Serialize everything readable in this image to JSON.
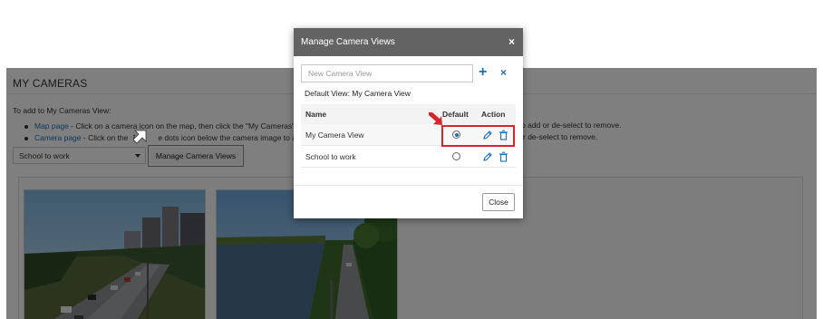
{
  "page": {
    "title": "MY CAMERAS",
    "intro": "To add to My Cameras View:",
    "bullet1_link": "Map page",
    "bullet1_text": " - Click on a camera icon on the map, then click the \"My Cameras\" bu",
    "bullet1_tail": "o add or de-select to remove.",
    "bullet2_link": "Camera page",
    "bullet2_text": " - Click on the  ",
    "bullet2_mid": "e dots icon below the camera image to acce",
    "bullet2_tail": "r de-select to remove.",
    "view_select_value": "School to work",
    "manage_button": "Manage Camera Views"
  },
  "modal": {
    "title": "Manage Camera Views",
    "close_symbol": "×",
    "input_placeholder": "New Camera View",
    "add_symbol": "+",
    "clear_symbol": "×",
    "default_view_text": "Default View: My Camera View",
    "columns": {
      "name": "Name",
      "default": "Default",
      "action": "Action"
    },
    "rows": [
      {
        "name": "My Camera View",
        "is_default": true
      },
      {
        "name": "School to work",
        "is_default": false
      }
    ],
    "close_button": "Close"
  },
  "colors": {
    "header_bg": "#636363",
    "accent": "#1b6fb5",
    "highlight": "#d9232d"
  }
}
